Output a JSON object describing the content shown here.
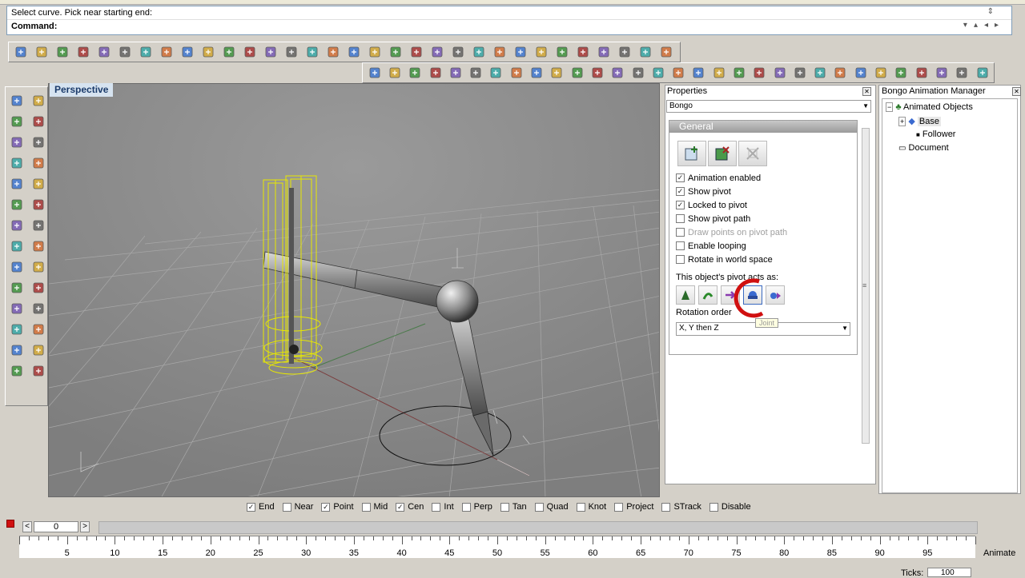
{
  "command": {
    "prompt": "Select curve. Pick near starting end:",
    "label": "Command:"
  },
  "viewport": {
    "tab": "Perspective"
  },
  "properties": {
    "title": "Properties",
    "selector": "Bongo",
    "group_title": "General",
    "checkboxes": [
      {
        "label": "Animation enabled",
        "checked": true,
        "enabled": true
      },
      {
        "label": "Show pivot",
        "checked": true,
        "enabled": true
      },
      {
        "label": "Locked to pivot",
        "checked": true,
        "enabled": true
      },
      {
        "label": "Show pivot path",
        "checked": false,
        "enabled": true
      },
      {
        "label": "Draw points on pivot path",
        "checked": false,
        "enabled": false
      },
      {
        "label": "Enable looping",
        "checked": false,
        "enabled": true
      },
      {
        "label": "Rotate in world space",
        "checked": false,
        "enabled": true
      }
    ],
    "pivot_label": "This object's pivot acts as:",
    "tooltip": "Joint",
    "rotation_label": "Rotation order",
    "rotation_value": "X, Y then Z"
  },
  "bam": {
    "title": "Bongo Animation Manager",
    "root": "Animated Objects",
    "base": "Base",
    "follower": "Follower",
    "document": "Document"
  },
  "osnap": [
    {
      "label": "End",
      "checked": true
    },
    {
      "label": "Near",
      "checked": false
    },
    {
      "label": "Point",
      "checked": true
    },
    {
      "label": "Mid",
      "checked": false
    },
    {
      "label": "Cen",
      "checked": true
    },
    {
      "label": "Int",
      "checked": false
    },
    {
      "label": "Perp",
      "checked": false
    },
    {
      "label": "Tan",
      "checked": false
    },
    {
      "label": "Quad",
      "checked": false
    },
    {
      "label": "Knot",
      "checked": false
    },
    {
      "label": "Project",
      "checked": false
    },
    {
      "label": "STrack",
      "checked": false
    },
    {
      "label": "Disable",
      "checked": false
    }
  ],
  "timeline": {
    "frame": "0",
    "animate_label": "Animate",
    "ticks_label": "Ticks:",
    "ticks_value": "100",
    "tick_labels": [
      "5",
      "10",
      "15",
      "20",
      "25",
      "30",
      "35",
      "40",
      "45",
      "50",
      "55",
      "60",
      "65",
      "70",
      "75",
      "80",
      "85",
      "90",
      "95"
    ]
  }
}
